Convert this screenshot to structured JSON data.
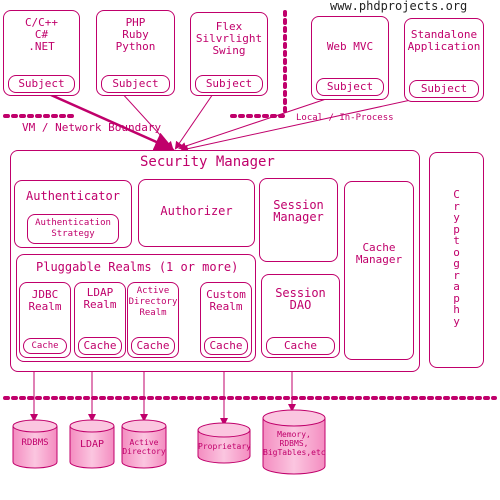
{
  "header": {
    "site": "www.phdprojects.org"
  },
  "clients": [
    {
      "label": "C/C++\nC#\n.NET",
      "subject": "Subject"
    },
    {
      "label": "PHP\nRuby\nPython",
      "subject": "Subject"
    },
    {
      "label": "Flex\nSilvrlight\nSwing",
      "subject": "Subject"
    },
    {
      "label": "Web MVC",
      "subject": "Subject"
    },
    {
      "label": "Standalone\nApplication",
      "subject": "Subject"
    }
  ],
  "boundaries": {
    "vm": "VM / Network Boundary",
    "local": "Local / In-Process"
  },
  "security_manager": {
    "title": "Security Manager",
    "authenticator": "Authenticator",
    "auth_strategy": "Authentication\nStrategy",
    "authorizer": "Authorizer",
    "session_manager": "Session\nManager",
    "session_dao": "Session\nDAO",
    "session_cache": "Cache",
    "cache_manager": "Cache\nManager",
    "realms_title": "Pluggable Realms (1 or more)",
    "realms": [
      {
        "label": "JDBC\nRealm",
        "cache": "Cache"
      },
      {
        "label": "LDAP\nRealm",
        "cache": "Cache"
      },
      {
        "label": "Active\nDirectory\nRealm",
        "cache": "Cache"
      },
      {
        "label": "Custom\nRealm",
        "cache": "Cache"
      }
    ]
  },
  "cryptography": "C\nr\ny\np\nt\no\ng\nr\na\np\nh\ny",
  "datastores": [
    {
      "label": "RDBMS"
    },
    {
      "label": "LDAP"
    },
    {
      "label": "Active\nDirectory"
    },
    {
      "label": "Proprietary"
    },
    {
      "label": "Memory,\nRDBMS,\nBigTables,etc"
    }
  ],
  "colors": {
    "accent": "#c0006b",
    "cylinder_fill": "#f7a8cf"
  }
}
